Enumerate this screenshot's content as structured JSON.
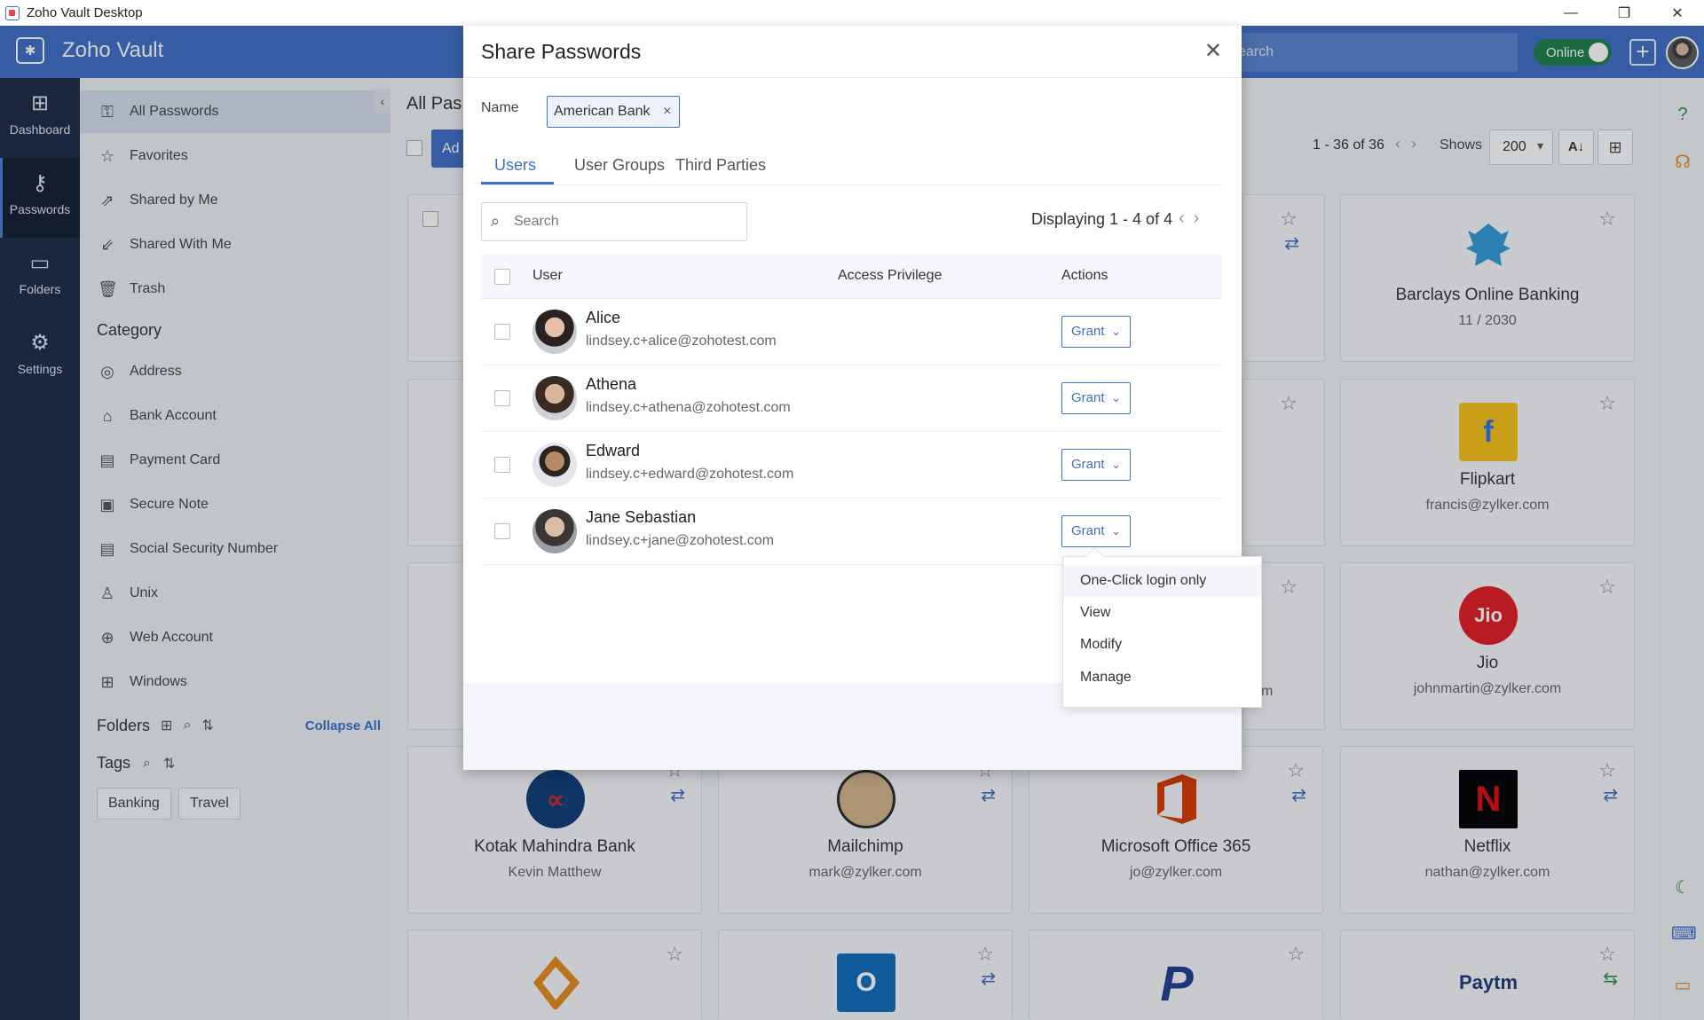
{
  "window": {
    "title": "Zoho Vault Desktop"
  },
  "header": {
    "brand": "Zoho Vault",
    "search_placeholder": "earch",
    "status": "Online"
  },
  "leftnav": [
    {
      "label": "Dashboard",
      "icon": "dashboard-icon"
    },
    {
      "label": "Passwords",
      "icon": "key-icon"
    },
    {
      "label": "Folders",
      "icon": "folder-icon"
    },
    {
      "label": "Settings",
      "icon": "gear-icon"
    }
  ],
  "sidebar": {
    "items": [
      {
        "label": "All Passwords",
        "icon": "all-passwords-icon"
      },
      {
        "label": "Favorites",
        "icon": "star-icon"
      },
      {
        "label": "Shared by Me",
        "icon": "shared-by-me-icon"
      },
      {
        "label": "Shared With Me",
        "icon": "shared-with-me-icon"
      },
      {
        "label": "Trash",
        "icon": "trash-icon"
      }
    ],
    "category_heading": "Category",
    "categories": [
      {
        "label": "Address",
        "icon": "address-icon"
      },
      {
        "label": "Bank Account",
        "icon": "bank-icon"
      },
      {
        "label": "Payment Card",
        "icon": "card-icon"
      },
      {
        "label": "Secure Note",
        "icon": "secure-note-icon"
      },
      {
        "label": "Social Security Number",
        "icon": "ssn-icon"
      },
      {
        "label": "Unix",
        "icon": "unix-icon"
      },
      {
        "label": "Web Account",
        "icon": "web-icon"
      },
      {
        "label": "Windows",
        "icon": "windows-icon"
      }
    ],
    "folders_heading": "Folders",
    "collapse_all": "Collapse All",
    "tags_heading": "Tags",
    "tags": [
      "Banking",
      "Travel"
    ]
  },
  "main": {
    "title": "All Pas",
    "add_label": "Ad",
    "pager": "1 - 36 of 36",
    "shows_label": "Shows",
    "shows_value": "200",
    "cards": [
      {
        "name": "Barclays Online Banking",
        "sub": "11 / 2030"
      },
      {
        "name": "Flipkart",
        "sub": "francis@zylker.com"
      },
      {
        "name": "Jio",
        "sub": "johnmartin@zylker.com"
      },
      {
        "name": "Kotak Mahindra Bank",
        "sub": "Kevin Matthew"
      },
      {
        "name": "Mailchimp",
        "sub": "mark@zylker.com"
      },
      {
        "name": "Microsoft Office 365",
        "sub": "jo@zylker.com"
      },
      {
        "name": "Netflix",
        "sub": "nathan@zylker.com"
      }
    ],
    "partial_card_text": "m",
    "logo_text": {
      "jio": "Jio",
      "netflix": "N",
      "outlook": "O",
      "paypal": "P",
      "paytm": "Paytm"
    }
  },
  "modal": {
    "title": "Share Passwords",
    "name_label": "Name",
    "name_chip": "American Bank",
    "tabs": [
      "Users",
      "User Groups",
      "Third Parties"
    ],
    "search_placeholder": "Search",
    "displaying": "Displaying 1 - 4 of 4",
    "columns": {
      "user": "User",
      "access": "Access Privilege",
      "actions": "Actions"
    },
    "grant_label": "Grant",
    "users": [
      {
        "name": "Alice",
        "email": "lindsey.c+alice@zohotest.com"
      },
      {
        "name": "Athena",
        "email": "lindsey.c+athena@zohotest.com"
      },
      {
        "name": "Edward",
        "email": "lindsey.c+edward@zohotest.com"
      },
      {
        "name": "Jane Sebastian",
        "email": "lindsey.c+jane@zohotest.com"
      }
    ]
  },
  "dropdown": {
    "options": [
      "One-Click login only",
      "View",
      "Modify",
      "Manage"
    ]
  },
  "colors": {
    "header_blue": "#3f6fc6",
    "nav_dark": "#1e2b45",
    "online_green": "#1f7f4b"
  }
}
